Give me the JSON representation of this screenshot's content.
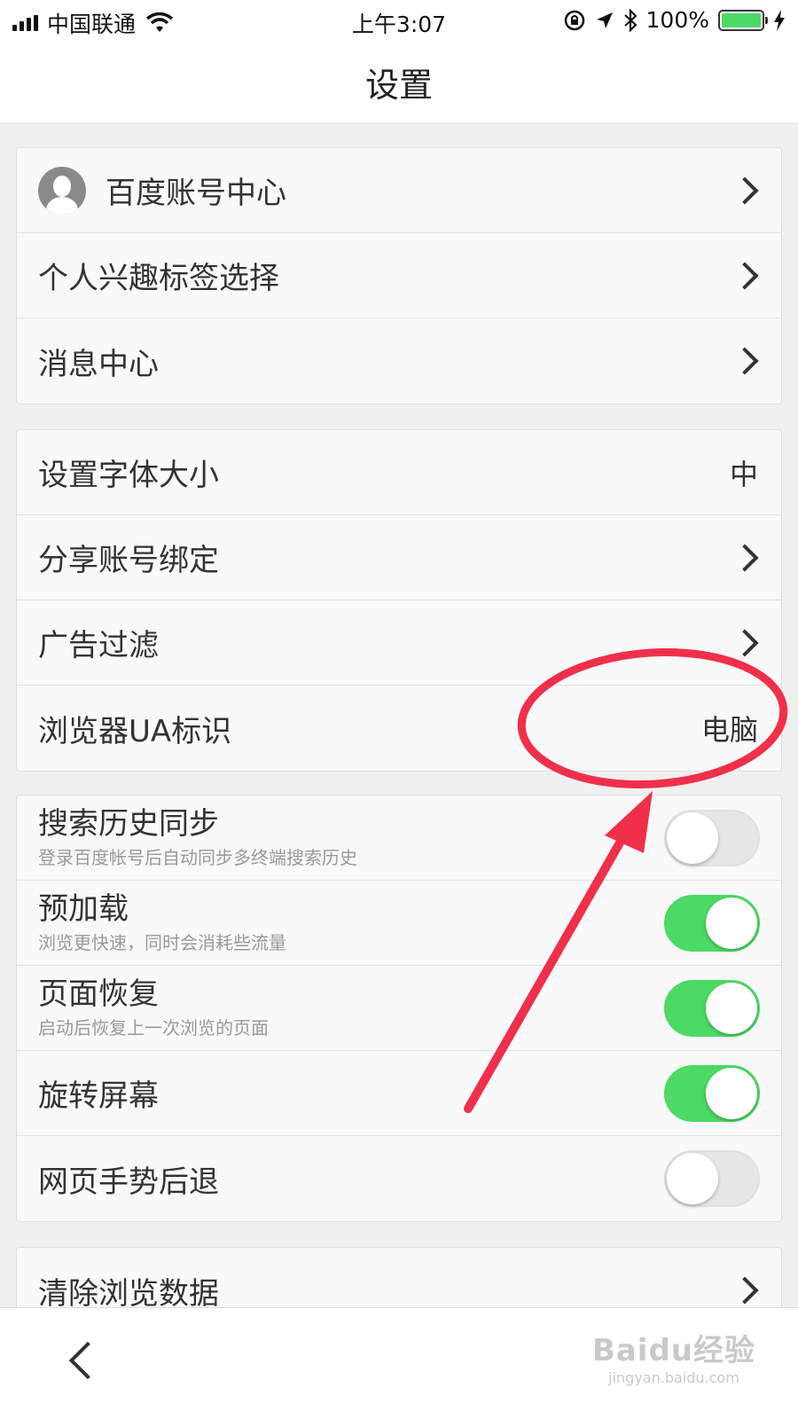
{
  "status_bar": {
    "carrier": "中国联通",
    "time": "上午3:07",
    "battery": "100%",
    "battery_level": 1.0,
    "icons": [
      "signal-icon",
      "wifi-icon",
      "rotation-lock-icon",
      "location-icon",
      "bluetooth-icon",
      "battery-icon",
      "charging-icon"
    ]
  },
  "nav": {
    "title": "设置"
  },
  "group1": {
    "account": "百度账号中心",
    "interest_tags": "个人兴趣标签选择",
    "message_center": "消息中心"
  },
  "group2": {
    "font_size_label": "设置字体大小",
    "font_size_value": "中",
    "share_binding": "分享账号绑定",
    "ad_filter": "广告过滤",
    "ua_label": "浏览器UA标识",
    "ua_value": "电脑"
  },
  "group3": {
    "items": [
      {
        "label": "搜索历史同步",
        "sub": "登录百度帐号后自动同步多终端搜索历史",
        "on": false
      },
      {
        "label": "预加载",
        "sub": "浏览更快速，同时会消耗些流量",
        "on": true
      },
      {
        "label": "页面恢复",
        "sub": "启动后恢复上一次浏览的页面",
        "on": true
      },
      {
        "label": "旋转屏幕",
        "on": true
      },
      {
        "label": "网页手势后退",
        "on": false
      }
    ]
  },
  "group4": {
    "clear_data": "清除浏览数据"
  },
  "watermark": {
    "line1": "Baidu经验",
    "line2": "jingyan.baidu.com"
  },
  "colors": {
    "toggle_on": "#4cd964",
    "annotation": "#f0304a"
  }
}
